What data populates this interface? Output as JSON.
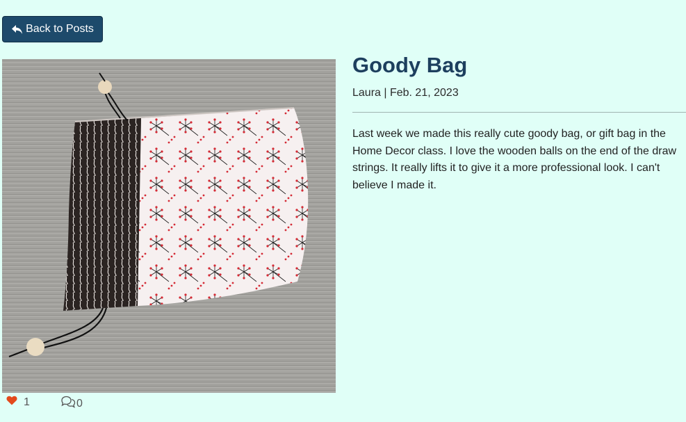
{
  "nav": {
    "back_label": "Back to Posts"
  },
  "post": {
    "title": "Goody Bag",
    "meta": "Laura | Feb. 21, 2023",
    "body": "Last week we made this really cute goody bag, or gift bag in the Home Decor class. I love the wooden balls on the end of the draw strings. It really lifts it to give it a more professional look. I can't believe I made it.",
    "likes": "1",
    "comments": "0"
  },
  "icons": {
    "back": "reply-arrow-icon",
    "like": "heart-icon",
    "comment": "comments-icon"
  },
  "colors": {
    "background": "#e0fff7",
    "button": "#1d4a6b",
    "title": "#1d3f5e",
    "heart": "#e34a1c"
  }
}
